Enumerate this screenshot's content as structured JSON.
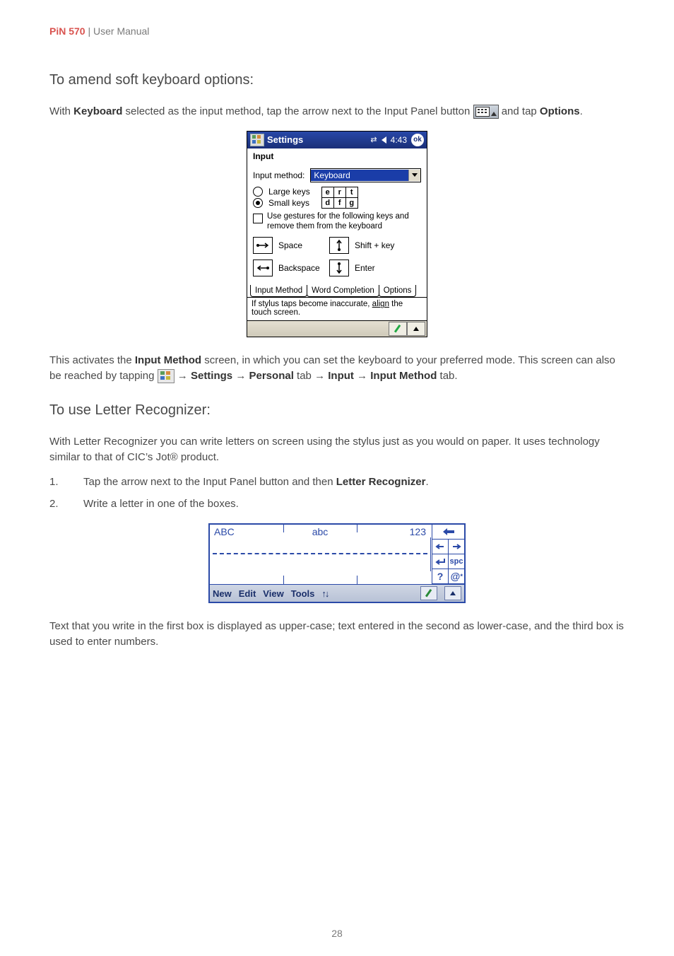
{
  "header": {
    "brand": "PiN 570",
    "rest": " | User Manual"
  },
  "page_number": "28",
  "sec1": {
    "heading": "To amend soft keyboard options:",
    "p1_a": "With ",
    "p1_b": "Keyboard",
    "p1_c": " selected as the input method, tap the arrow next to the Input Panel button ",
    "p1_d": " and tap ",
    "p1_e": "Options",
    "p1_f": ".",
    "p2_a": "This activates the ",
    "p2_b": "Input Method",
    "p2_c": " screen, in which you can set the keyboard to your preferred mode. This screen can also be reached by tapping ",
    "arrow": " → ",
    "p2_d": "Settings",
    "p2_e": "Personal",
    "p2_f": " tab ",
    "p2_g": "Input",
    "p2_h": "Input Method",
    "p2_i": " tab."
  },
  "ppc": {
    "title": "Settings",
    "time": "4:43",
    "ok": "ok",
    "subtitle": "Input",
    "input_method_label": "Input method:",
    "input_method_value": "Keyboard",
    "large_keys": "Large keys",
    "small_keys": "Small keys",
    "mini_row1": [
      "e",
      "r",
      "t"
    ],
    "mini_row2": [
      "d",
      "f",
      "g"
    ],
    "gestures": "Use gestures for the following keys and remove them from the keyboard",
    "space": "Space",
    "shiftkey": "Shift + key",
    "backspace": "Backspace",
    "enter": "Enter",
    "tabs": [
      "Input Method",
      "Word Completion",
      "Options"
    ],
    "hint_a": "If stylus taps become inaccurate, ",
    "hint_link": "align",
    "hint_b": " the touch screen."
  },
  "sec2": {
    "heading": "To use Letter Recognizer:",
    "p1": "With Letter Recognizer you can write letters on screen using the stylus just as you would on paper.  It uses technology similar to that of CIC’s Jot® product.",
    "step1_num": "1.",
    "step1_a": "Tap the arrow next to the Input Panel button and then ",
    "step1_b": "Letter Recognizer",
    "step1_c": ".",
    "step2_num": "2.",
    "step2": "Write a letter in one of the boxes.",
    "p3": "Text that you write in the first box is displayed as upper-case; text entered in the second as lower-case, and the third box is used to enter numbers."
  },
  "lr": {
    "zones": [
      "ABC",
      "abc",
      "123"
    ],
    "side": {
      "spc": "spc",
      "q": "?",
      "at": "@"
    },
    "menu": [
      "New",
      "Edit",
      "View",
      "Tools"
    ],
    "arrows": "↑↓"
  }
}
